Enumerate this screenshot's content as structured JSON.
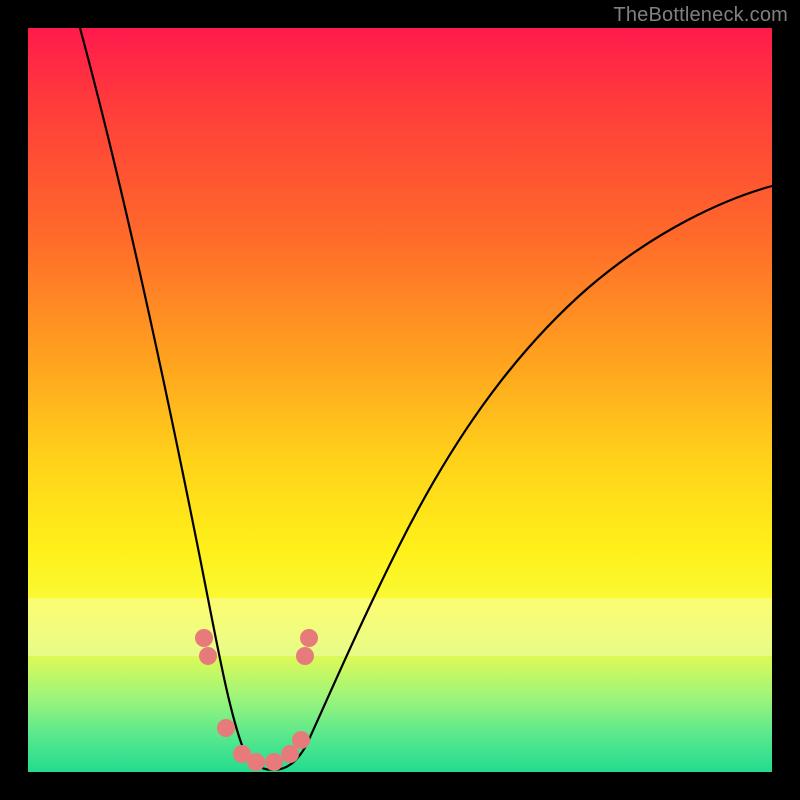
{
  "watermark": "TheBottleneck.com",
  "chart_data": {
    "type": "line",
    "title": "",
    "xlabel": "",
    "ylabel": "",
    "xlim": [
      0,
      100
    ],
    "ylim": [
      0,
      100
    ],
    "grid": false,
    "series": [
      {
        "name": "bottleneck-curve",
        "x": [
          7,
          10,
          13,
          16,
          19,
          22,
          25,
          26,
          28,
          30,
          32,
          34,
          36,
          38,
          42,
          46,
          50,
          55,
          60,
          66,
          72,
          80,
          90,
          100
        ],
        "y": [
          100,
          84,
          68,
          53,
          40,
          27,
          14,
          9,
          4,
          1,
          0,
          0,
          1,
          3,
          9,
          16,
          24,
          32,
          40,
          48,
          55,
          62,
          70,
          76
        ]
      }
    ],
    "markers": [
      {
        "x": 23.5,
        "y": 18
      },
      {
        "x": 24.0,
        "y": 16
      },
      {
        "x": 26.5,
        "y": 6
      },
      {
        "x": 28.5,
        "y": 2.5
      },
      {
        "x": 30.5,
        "y": 1.5
      },
      {
        "x": 33.0,
        "y": 1.5
      },
      {
        "x": 35.0,
        "y": 2.5
      },
      {
        "x": 36.5,
        "y": 4.5
      },
      {
        "x": 37.0,
        "y": 16
      },
      {
        "x": 37.5,
        "y": 18
      }
    ],
    "marker_style": {
      "color": "#e77b7b",
      "radius_px": 9
    },
    "background": {
      "type": "vertical-gradient",
      "stops": [
        {
          "pos": 0.0,
          "color": "#ff1a4d"
        },
        {
          "pos": 0.7,
          "color": "#fff01a"
        },
        {
          "pos": 1.0,
          "color": "#22dc8f"
        }
      ]
    }
  }
}
